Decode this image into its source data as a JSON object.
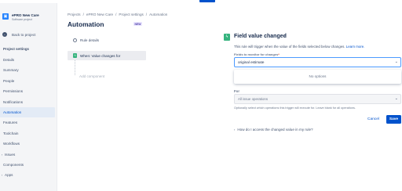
{
  "sidebar": {
    "project_name": "ePRO New Care",
    "project_type": "Software project",
    "back_label": "Back to project",
    "section_title": "Project settings",
    "items": [
      {
        "label": "Details"
      },
      {
        "label": "Summary"
      },
      {
        "label": "People"
      },
      {
        "label": "Permissions"
      },
      {
        "label": "Notifications"
      },
      {
        "label": "Automation",
        "active": true
      },
      {
        "label": "Features"
      },
      {
        "label": "Toolchain"
      },
      {
        "label": "Workflows"
      },
      {
        "label": "Issues",
        "expandable": true
      },
      {
        "label": "Components"
      },
      {
        "label": "Apps",
        "expandable": true
      }
    ]
  },
  "breadcrumb": [
    "Projects",
    "/",
    "ePRO New Care",
    "/",
    "Project settings",
    "/",
    "Automation"
  ],
  "page": {
    "title": "Automation",
    "badge": "NEW"
  },
  "rule": {
    "details_label": "Rule details",
    "trigger_label": "When: Value changes for",
    "add_component_label": "Add component"
  },
  "panel": {
    "title": "Field value changed",
    "description": "This rule will trigger when the value of the fields selected below changes.",
    "learn_more": "Learn more.",
    "field_label": "Fields to monitor for changes",
    "field_required_mark": "*",
    "field_value": "original estimate",
    "dropdown_empty": "No options",
    "for_label": "For",
    "for_value": "All issue operations",
    "for_help": "Optionally select which operations this trigger will execute for. Leave blank for all operations.",
    "cancel_label": "Cancel",
    "save_label": "Save",
    "howto_label": "How do I access the changed value in my rule?"
  },
  "colors": {
    "primary": "#0052cc",
    "trigger_green": "#36b37e",
    "active_bg": "#e3ebf6"
  }
}
